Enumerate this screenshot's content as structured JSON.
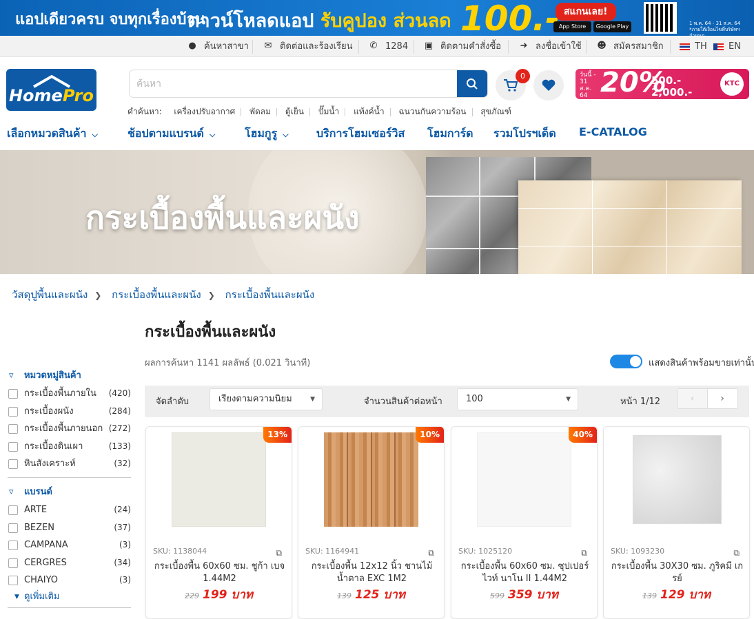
{
  "top_banner": {
    "left_text": "แอปเดียวครบ จบทุกเรื่องบ้าน",
    "promo_text": "ดาวน์โหลดแอป",
    "promo_highlight": "รับคูปอง",
    "promo_discount": "ส่วนลด",
    "promo_amount": "100.-",
    "scan_label": "สแกนเลย!",
    "app_store": "App Store",
    "google_play": "Google Play",
    "date_note": "1 พ.ค. 64 - 31 ส.ค. 64",
    "date_note2": "*ภายใต้เงื่อนไขที่บริษัทฯกำหนด"
  },
  "utility_bar": {
    "find_branch": "ค้นหาสาขา",
    "contact": "ติดต่อและร้องเรียน",
    "hotline": "1284",
    "track_order": "ติดตามคำสั่งซื้อ",
    "login": "ลงชื่อเข้าใช้",
    "register": "สมัครสมาชิก",
    "lang_th": "TH",
    "lang_en": "EN"
  },
  "header": {
    "logo_home": "Home",
    "logo_pro": "Pro",
    "search_placeholder": "ค้นหา",
    "cart_count": "0",
    "ktc_line1": "วันนี้ - 31 ส.ค. 64",
    "ktc_pct": "20%",
    "ktc_amt1": "500.-",
    "ktc_amt2": "2,000.-",
    "ktc_brand": "KTC",
    "popular_label": "คำค้นหา:",
    "popular": [
      "เครื่องปรับอากาศ",
      "พัดลม",
      "ตู้เย็น",
      "ปั๊มน้ำ",
      "แท้งค์น้ำ",
      "ฉนวนกันความร้อน",
      "สุขภัณฑ์"
    ]
  },
  "main_nav": {
    "categories": "เลือกหมวดสินค้า",
    "brands": "ช้อปตามแบรนด์",
    "homeguru": "โฮมกูรู",
    "service": "บริการโฮมเซอร์วิส",
    "card": "โฮมการ์ด",
    "promo": "รวมโปรฯเด็ด",
    "catalog": "E-CATALOG"
  },
  "hero": {
    "title": "กระเบื้องพื้นและผนัง"
  },
  "breadcrumb": [
    "วัสดุปูพื้นและผนัง",
    "กระเบื้องพื้นและผนัง",
    "กระเบื้องพื้นและผนัง"
  ],
  "page_title": "กระเบื้องพื้นและผนัง",
  "result_text": "ผลการค้นหา 1141 ผลลัพธ์ (0.021 วินาที)",
  "in_stock_toggle": {
    "label": "แสดงสินค้าพร้อมขายเท่านั้น",
    "on": true
  },
  "sort_bar": {
    "sort_label": "จัดลำดับ",
    "sort_value": "เรียงตามความนิยม",
    "per_page_label": "จำนวนสินค้าต่อหน้า",
    "per_page_value": "100",
    "page_info": "หน้า 1/12",
    "prev": "‹",
    "next": "›"
  },
  "filters": {
    "category_title": "หมวดหมู่สินค้า",
    "categories": [
      {
        "label": "กระเบื้องพื้นภายใน",
        "count": "(420)"
      },
      {
        "label": "กระเบื้องผนัง",
        "count": "(284)"
      },
      {
        "label": "กระเบื้องพื้นภายนอก",
        "count": "(272)"
      },
      {
        "label": "กระเบื้องดินเผา",
        "count": "(133)"
      },
      {
        "label": "หินสังเคราะห์",
        "count": "(32)"
      }
    ],
    "brand_title": "แบรนด์",
    "brands": [
      {
        "label": "ARTE",
        "count": "(24)"
      },
      {
        "label": "BEZEN",
        "count": "(37)"
      },
      {
        "label": "CAMPANA",
        "count": "(3)"
      },
      {
        "label": "CERGRES",
        "count": "(34)"
      },
      {
        "label": "CHAIYO",
        "count": "(3)"
      }
    ],
    "see_more": "ดูเพิ่มเติม"
  },
  "products": [
    {
      "sku": "SKU: 1138044",
      "name": "กระเบื้องพื้น 60x60 ซม. ชูก้า เบจ 1.44M2",
      "old_price": "229",
      "price": "199 บาท",
      "discount": "13%",
      "swatch": "#ecebe3"
    },
    {
      "sku": "SKU: 1164941",
      "name": "กระเบื้องพื้น 12x12 นิ้ว ชานไม้ น้ำตาล EXC 1M2",
      "old_price": "139",
      "price": "125 บาท",
      "discount": "10%",
      "swatch": "#c98a55"
    },
    {
      "sku": "SKU: 1025120",
      "name": "กระเบื้องพื้น 60x60 ซม. ซุปเปอร์ไวท์ นาโน II 1.44M2",
      "old_price": "599",
      "price": "359 บาท",
      "discount": "40%",
      "swatch": "#f6f6f6"
    },
    {
      "sku": "SKU: 1093230",
      "name": "กระเบื้องพื้น 30X30 ซม. ภูริคมี เกรย์",
      "old_price": "139",
      "price": "129 บาท",
      "discount": "",
      "swatch": "#e4e4e4"
    }
  ],
  "colors": {
    "brand_blue": "#0e5aa7",
    "sale_red": "#e2231a",
    "ktc_pink": "#d8185a"
  }
}
